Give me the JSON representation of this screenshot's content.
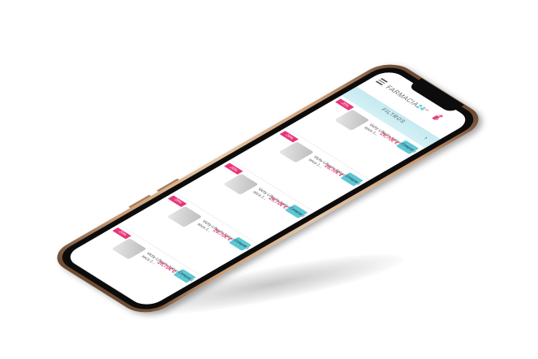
{
  "app": {
    "brand_prefix": "FARMACIA",
    "brand_suffix": "24"
  },
  "filter_label": "FILTROS",
  "products": [
    {
      "tag": "-20%",
      "name": "Vichy Liftactiv Antiarrugas Piel seca 1...",
      "price": "26,70€ €",
      "button": "Comprar"
    },
    {
      "tag": "-20%",
      "name": "Vichy Liftactiv Antiarrugas Piel seca 1...",
      "price": "26,70€ €",
      "button": "Comprar"
    },
    {
      "tag": "-20%",
      "name": "Vichy Liftactiv Antiarrugas Piel seca 1...",
      "price": "26,70€ €",
      "button": "Comprar"
    },
    {
      "tag": "-20%",
      "name": "Vichy Liftactiv Antiarrugas Piel seca 1...",
      "price": "26,70€ €",
      "button": "Comprar"
    },
    {
      "tag": "-20%",
      "name": "Vichy Liftactiv Antiarrugas Piel seca 1...",
      "price": "26,70€ €",
      "button": "Comprar"
    }
  ],
  "colors": {
    "accent": "#38b6c6",
    "brand_pink": "#e53f6f",
    "phone_gold": "#c89a74"
  },
  "icons": [
    "menu-icon",
    "cart-icon",
    "user-icon",
    "chevron-down-icon"
  ]
}
